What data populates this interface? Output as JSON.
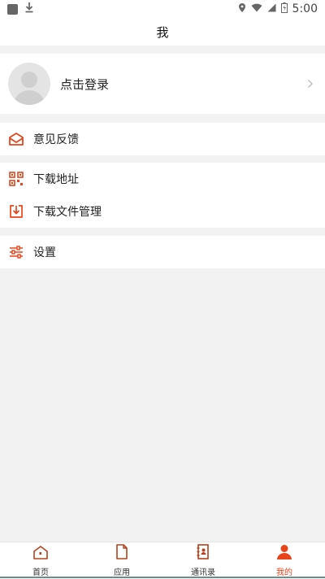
{
  "statusbar": {
    "time": "5:00"
  },
  "header": {
    "title": "我"
  },
  "profile": {
    "login_label": "点击登录"
  },
  "menu": {
    "feedback_label": "意见反馈",
    "download_address_label": "下载地址",
    "download_manager_label": "下载文件管理",
    "settings_label": "设置"
  },
  "tabs": [
    {
      "label": "首页",
      "icon": "home-icon"
    },
    {
      "label": "应用",
      "icon": "document-icon"
    },
    {
      "label": "通讯录",
      "icon": "contacts-icon"
    },
    {
      "label": "我的",
      "icon": "user-icon"
    }
  ],
  "colors": {
    "accent": "#e8441c",
    "icon_dark": "#b8401c",
    "background": "#f2f2f2"
  },
  "active_tab": "我的"
}
